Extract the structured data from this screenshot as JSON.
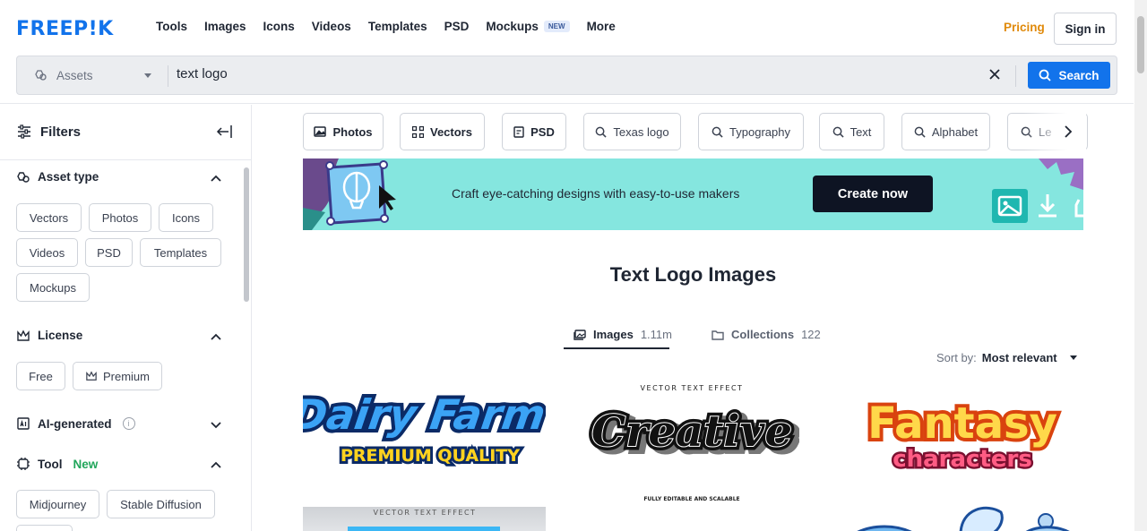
{
  "brand": {
    "logo": "FREEP!K"
  },
  "nav": [
    {
      "label": "Tools"
    },
    {
      "label": "Images"
    },
    {
      "label": "Icons"
    },
    {
      "label": "Videos"
    },
    {
      "label": "Templates"
    },
    {
      "label": "PSD"
    },
    {
      "label": "Mockups",
      "badge": "NEW"
    },
    {
      "label": "More"
    }
  ],
  "header": {
    "pricing": "Pricing",
    "signin": "Sign in"
  },
  "search": {
    "scope": "Assets",
    "query": "text logo",
    "button": "Search"
  },
  "sidebar": {
    "title": "Filters",
    "asset_type": {
      "title": "Asset type",
      "options": [
        "Vectors",
        "Photos",
        "Icons",
        "Videos",
        "PSD",
        "Templates",
        "Mockups"
      ]
    },
    "license": {
      "title": "License",
      "options": [
        "Free",
        "Premium"
      ]
    },
    "ai": {
      "title": "AI-generated",
      "info": "i"
    },
    "tool": {
      "title": "Tool",
      "badge": "New",
      "options": [
        "Midjourney",
        "Stable Diffusion"
      ]
    }
  },
  "tags": [
    "Photos",
    "Vectors",
    "PSD",
    "Texas logo",
    "Typography",
    "Text",
    "Alphabet",
    "Le"
  ],
  "banner": {
    "text": "Craft eye-catching designs with easy-to-use makers",
    "button": "Create now"
  },
  "main": {
    "title": "Text Logo Images",
    "tabs": [
      {
        "label": "Images",
        "count": "1.11m"
      },
      {
        "label": "Collections",
        "count": "122"
      }
    ],
    "sort_label": "Sort by:",
    "sort_value": "Most relevant"
  },
  "thumbnails": [
    {
      "line1": "Dairy Farm",
      "line2": "PREMIUM QUALITY"
    },
    {
      "top": "VECTOR TEXT EFFECT",
      "line1": "Creative",
      "bottom": "FULLY EDITABLE AND SCALABLE"
    },
    {
      "line1": "Fantasy",
      "line2": "characters"
    },
    {
      "top": "VECTOR TEXT EFFECT"
    }
  ],
  "colors": {
    "brand": "#1273eb",
    "pricing": "#e08a0b",
    "banner": "#85e6df",
    "new": "#21a65b"
  }
}
